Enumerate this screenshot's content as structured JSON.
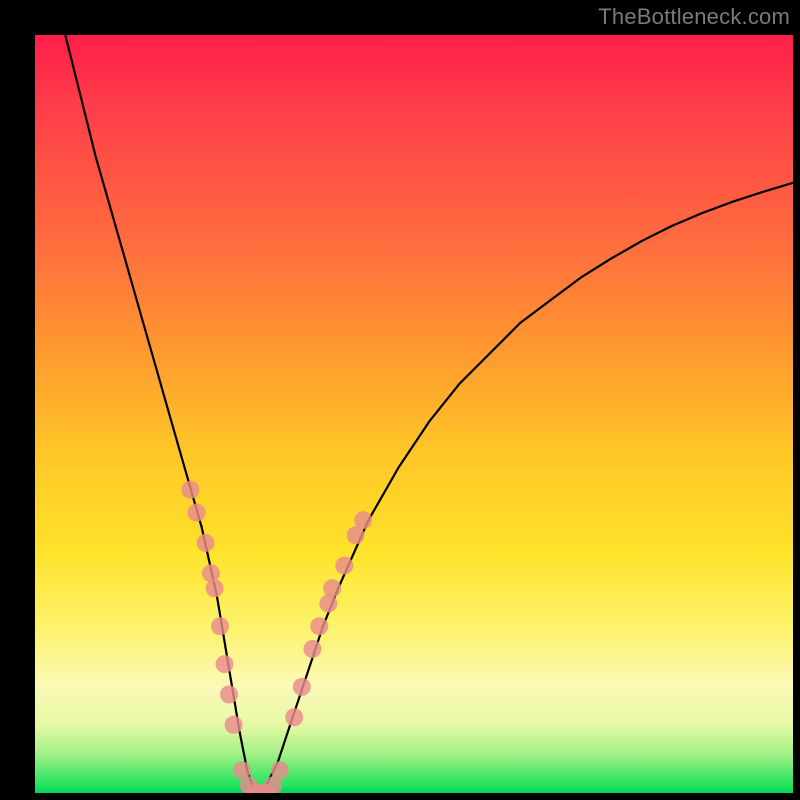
{
  "watermark": "TheBottleneck.com",
  "chart_data": {
    "type": "line",
    "title": "",
    "xlabel": "",
    "ylabel": "",
    "xlim": [
      0,
      100
    ],
    "ylim": [
      0,
      100
    ],
    "background_gradient": {
      "direction": "vertical",
      "stops": [
        {
          "pos": 0.0,
          "color": "#ff1e4a"
        },
        {
          "pos": 0.1,
          "color": "#ff3f49"
        },
        {
          "pos": 0.28,
          "color": "#ff6e3e"
        },
        {
          "pos": 0.42,
          "color": "#ff9a2f"
        },
        {
          "pos": 0.55,
          "color": "#ffc627"
        },
        {
          "pos": 0.68,
          "color": "#ffe22a"
        },
        {
          "pos": 0.78,
          "color": "#fdf36a"
        },
        {
          "pos": 0.86,
          "color": "#fbf9b8"
        },
        {
          "pos": 0.91,
          "color": "#e7f9a4"
        },
        {
          "pos": 0.95,
          "color": "#9ef084"
        },
        {
          "pos": 0.99,
          "color": "#22e35e"
        },
        {
          "pos": 1.0,
          "color": "#00d756"
        }
      ]
    },
    "series": [
      {
        "name": "bottleneck-curve",
        "x": [
          4,
          6,
          8,
          10,
          12,
          14,
          16,
          18,
          20,
          22,
          24,
          25,
          26,
          27,
          28,
          29,
          30,
          32,
          34,
          36,
          38,
          40,
          44,
          48,
          52,
          56,
          60,
          64,
          68,
          72,
          76,
          80,
          84,
          88,
          92,
          96,
          100
        ],
        "y": [
          100,
          92,
          84,
          77,
          70,
          63,
          56,
          49,
          42,
          35,
          26,
          20,
          14,
          8,
          3,
          0,
          0,
          4,
          10,
          16,
          22,
          27,
          36,
          43,
          49,
          54,
          58,
          62,
          65,
          68,
          70.5,
          72.8,
          74.8,
          76.5,
          78,
          79.3,
          80.5
        ]
      }
    ],
    "markers": {
      "name": "highlighted-points",
      "color": "#e98b8c",
      "points": [
        {
          "x": 20.5,
          "y": 40
        },
        {
          "x": 21.3,
          "y": 37
        },
        {
          "x": 22.5,
          "y": 33
        },
        {
          "x": 23.2,
          "y": 29
        },
        {
          "x": 23.7,
          "y": 27
        },
        {
          "x": 24.4,
          "y": 22
        },
        {
          "x": 25.0,
          "y": 17
        },
        {
          "x": 25.6,
          "y": 13
        },
        {
          "x": 26.2,
          "y": 9
        },
        {
          "x": 27.3,
          "y": 3
        },
        {
          "x": 28.2,
          "y": 1
        },
        {
          "x": 29.0,
          "y": 0
        },
        {
          "x": 29.8,
          "y": 0
        },
        {
          "x": 30.6,
          "y": 0
        },
        {
          "x": 31.4,
          "y": 1
        },
        {
          "x": 32.3,
          "y": 3
        },
        {
          "x": 34.2,
          "y": 10
        },
        {
          "x": 35.2,
          "y": 14
        },
        {
          "x": 36.6,
          "y": 19
        },
        {
          "x": 37.5,
          "y": 22
        },
        {
          "x": 38.7,
          "y": 25
        },
        {
          "x": 39.2,
          "y": 27
        },
        {
          "x": 40.8,
          "y": 30
        },
        {
          "x": 42.3,
          "y": 34
        },
        {
          "x": 43.3,
          "y": 36
        }
      ]
    }
  }
}
